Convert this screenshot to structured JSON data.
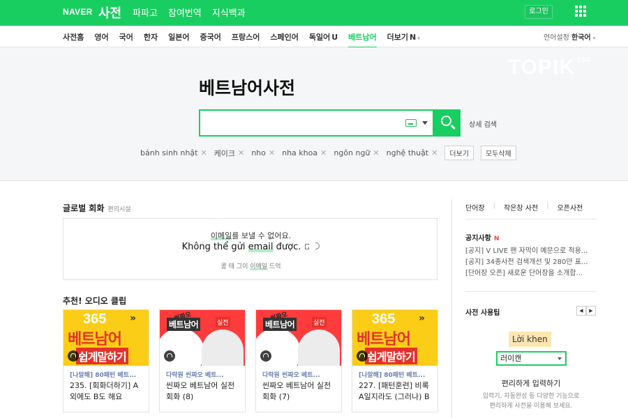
{
  "header": {
    "logo": "NAVER",
    "brand": "사전",
    "nav": [
      "파파고",
      "참여번역",
      "지식백과"
    ],
    "login": "로그인",
    "apps_icon": "grid-icon"
  },
  "subnav": {
    "items": [
      "사전홈",
      "영어",
      "국어",
      "한자",
      "일본어",
      "중국어",
      "프랑스어",
      "스페인어",
      "독일어",
      "베트남어",
      "더보기"
    ],
    "new_badge": "U",
    "more_badge": "N",
    "active": "베트남어",
    "lang_label": "언어설정",
    "lang_value": "한국어"
  },
  "hero": {
    "watermark": "TOPIK",
    "watermark_sup": "180",
    "title": "베트남어사전",
    "search_value": "",
    "search_placeholder": "",
    "advanced": "상세 검색",
    "recent": [
      "bánh sinh nhật",
      "케이크",
      "nho",
      "nha khoa",
      "ngôn ngữ",
      "nghệ thuật"
    ],
    "more_btn": "더보기",
    "clear_btn": "모두삭제"
  },
  "conversation": {
    "title": "글로벌 회화",
    "subtitle": "편의시설",
    "ko_pre": "",
    "ko_hl": "이메일",
    "ko_post": "를 보낼 수 없어요.",
    "vi_pre": "Không thể gửi ",
    "vi_hl": "email",
    "vi_post": " được.",
    "src_pre": "콩 테 그이 ",
    "src_hl": "이메일",
    "src_post": " 드억"
  },
  "audio": {
    "title": "추천! 오디오 클립",
    "cards": [
      {
        "category": "[나말해] 80패턴 베트...",
        "title": "235. [회화더하기] A 외에도 B도 해요",
        "thumb_main": "베트남어",
        "thumb_sub": "쉽게말하기",
        "thumb_num": "365"
      },
      {
        "category": "다락원 씬짜오 베트...",
        "title": "씬짜오 베트남어 실전 회화 (8)",
        "thumb_main": "베트남어",
        "thumb_tag": "실전",
        "thumb_stamp": "씬짜오"
      },
      {
        "category": "다락원 씬짜오 베트...",
        "title": "씬짜오 베트남어 실전 회화 (7)",
        "thumb_main": "베트남어",
        "thumb_tag": "실전",
        "thumb_stamp": "씬짜오"
      },
      {
        "category": "[나말해] 80패턴 베트...",
        "title": "227. [패턴훈련] 비록 A일지라도 (그러나) B",
        "thumb_main": "베트남어",
        "thumb_sub": "쉽게말하기",
        "thumb_num": "365"
      }
    ]
  },
  "sidebar": {
    "tabs": [
      "단어장",
      "작은창 사전",
      "오픈사전"
    ],
    "notice_title": "공지사항",
    "notice_badge": "N",
    "notices": [
      "[공지] V LIVE 팬 자막이 예문으로 적용...",
      "[공지] 34종사전 검색개선 및 280만 표...",
      "[단어장 오픈] 새로운 단어장을 소개합..."
    ],
    "tips_title": "사전 사용팁",
    "tip_badge": "Lời khen",
    "tip_select": "러이캔",
    "tip_head": "편리하게 입력하기",
    "tip_desc_1": "입력기, 자동완성 등 다양한 기능으로",
    "tip_desc_2": "편리하게 사전을 이용해 보세요."
  }
}
